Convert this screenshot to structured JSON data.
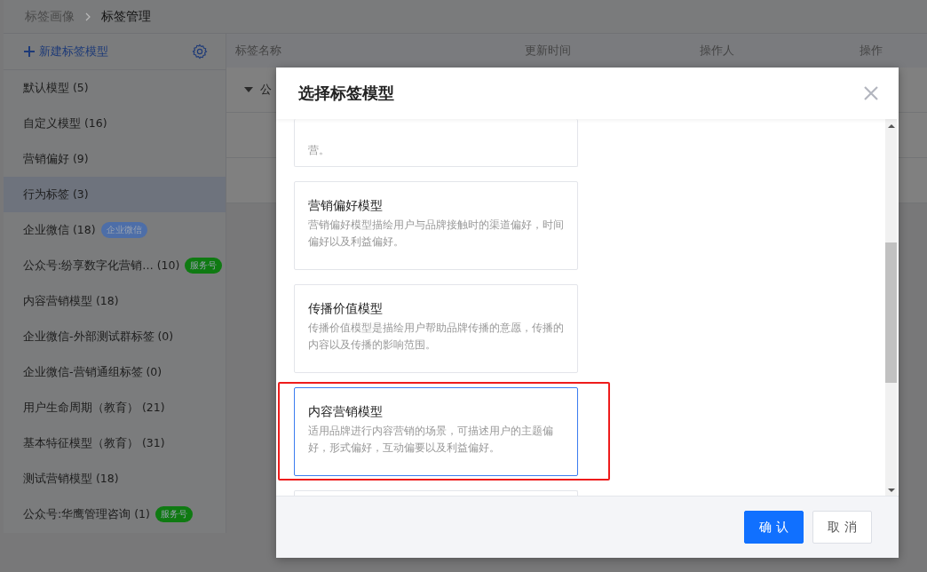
{
  "breadcrumb": [
    {
      "label": "标签画像",
      "current": false
    },
    {
      "label": "标签管理",
      "current": true
    }
  ],
  "sidebar": {
    "new_button": "新建标签模型",
    "items": [
      {
        "label": "默认模型",
        "count": "(5)",
        "selected": false
      },
      {
        "label": "自定义模型",
        "count": "(16)",
        "selected": false
      },
      {
        "label": "营销偏好",
        "count": "(9)",
        "selected": false
      },
      {
        "label": "行为标签",
        "count": "(3)",
        "selected": true
      },
      {
        "label": "企业微信",
        "count": "(18)",
        "selected": false,
        "badge": {
          "text": "企业微信",
          "color": "#4d6ea8"
        }
      },
      {
        "label": "公众号:纷享数字化营销…",
        "count": "(10)",
        "selected": false,
        "badge": {
          "text": "服务号",
          "color": "#0f7a12"
        }
      },
      {
        "label": "内容营销模型",
        "count": "(18)",
        "selected": false
      },
      {
        "label": "企业微信-外部测试群标签",
        "count": "(0)",
        "selected": false
      },
      {
        "label": "企业微信-营销通组标签",
        "count": "(0)",
        "selected": false
      },
      {
        "label": "用户生命周期（教育）",
        "count": "(21)",
        "selected": false
      },
      {
        "label": "基本特征模型（教育）",
        "count": "(31)",
        "selected": false
      },
      {
        "label": "测试营销模型",
        "count": "(18)",
        "selected": false
      },
      {
        "label": "公众号:华鹰管理咨询",
        "count": "(1)",
        "selected": false,
        "badge": {
          "text": "服务号",
          "color": "#0f7a12"
        }
      }
    ]
  },
  "table": {
    "columns": [
      "标签名称",
      "更新时间",
      "操作人",
      "操作"
    ],
    "rows": [
      {
        "name": "公",
        "expanded": true
      },
      {},
      {}
    ]
  },
  "dialog": {
    "title": "选择标签模型",
    "cards": [
      {
        "kind": "cut-top",
        "desc": "营。",
        "selected": false
      },
      {
        "kind": "full",
        "title": "营销偏好模型",
        "desc": "营销偏好模型描绘用户与品牌接触时的渠道偏好，时间偏好以及利益偏好。",
        "selected": false,
        "highlight": false
      },
      {
        "kind": "full",
        "title": "传播价值模型",
        "desc": "传播价值模型是描绘用户帮助品牌传播的意愿，传播的内容以及传播的影响范围。",
        "selected": false,
        "highlight": false
      },
      {
        "kind": "full",
        "title": "内容营销模型",
        "desc": "适用品牌进行内容营销的场景，可描述用户的主题偏好，形式偏好，互动偏要以及利益偏好。",
        "selected": true,
        "highlight": true
      },
      {
        "kind": "cut-bottom",
        "selected": false
      }
    ],
    "confirm": "确 认",
    "cancel": "取 消"
  }
}
